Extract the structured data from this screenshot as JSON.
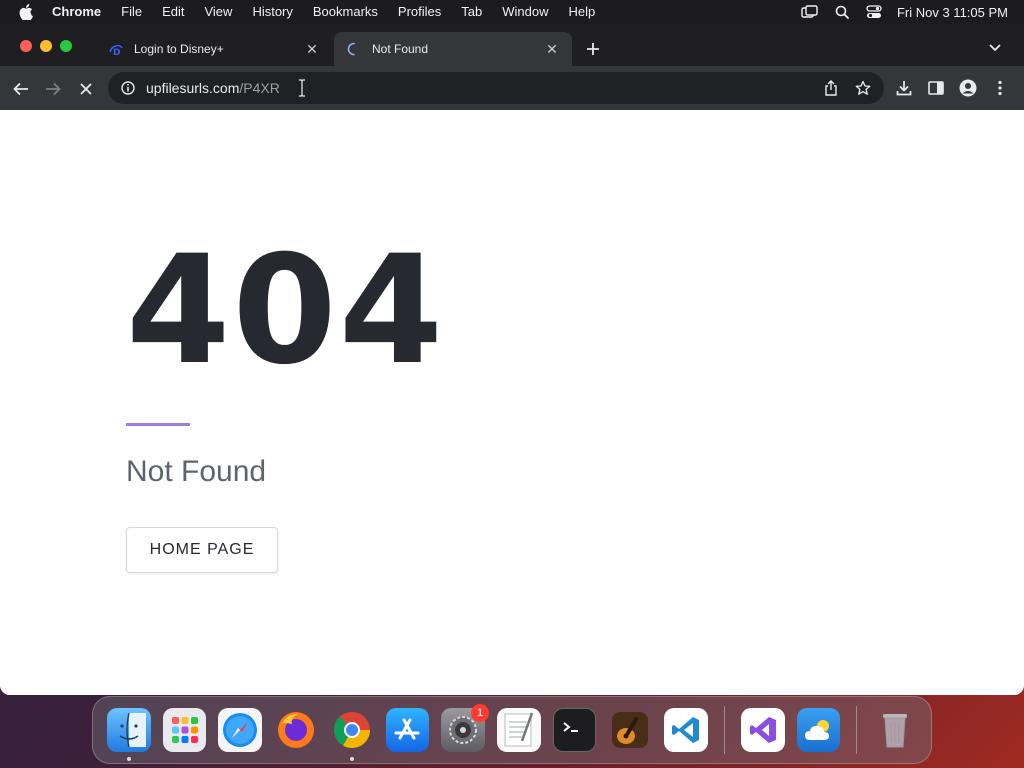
{
  "menubar": {
    "app": "Chrome",
    "items": [
      "File",
      "Edit",
      "View",
      "History",
      "Bookmarks",
      "Profiles",
      "Tab",
      "Window",
      "Help"
    ],
    "clock": "Fri Nov 3  11:05 PM",
    "status_icons": [
      "screen-mirroring-icon",
      "spotlight-search-icon",
      "control-center-icon"
    ]
  },
  "browser": {
    "tabs": [
      {
        "title": "Login to Disney+",
        "favicon": "disney-plus-icon",
        "active": false
      },
      {
        "title": "Not Found",
        "favicon": "loading-spinner-icon",
        "active": true
      }
    ],
    "url_host": "upfilesurls.com",
    "url_path": "/P4XR"
  },
  "page": {
    "code": "404",
    "message": "Not Found",
    "button_label": "HOME PAGE",
    "accent_color": "#a47ad9"
  },
  "dock": {
    "apps": [
      "Finder",
      "Launchpad",
      "Safari",
      "Firefox",
      "Chrome",
      "App Store",
      "System Settings",
      "TextEdit",
      "Terminal",
      "GarageBand",
      "Visual Studio Code",
      "Visual Studio",
      "Weather",
      "Trash"
    ],
    "system_settings_badge": "1"
  }
}
